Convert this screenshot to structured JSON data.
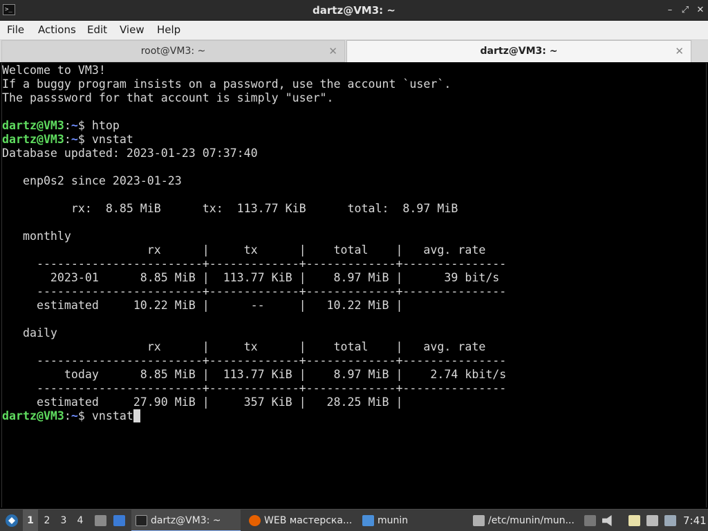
{
  "window": {
    "title": "dartz@VM3: ~",
    "app_icon_text": ">_",
    "minimize_glyph": "–",
    "maximize_glyph": "⤢",
    "close_glyph": "✕"
  },
  "menu": {
    "file": "File",
    "actions": "Actions",
    "edit": "Edit",
    "view": "View",
    "help": "Help"
  },
  "tabs": [
    {
      "label": "root@VM3: ~",
      "close": "✕",
      "active": false
    },
    {
      "label": "dartz@VM3: ~",
      "close": "✕",
      "active": true
    }
  ],
  "terminal": {
    "lines": [
      {
        "text": "Welcome to VM3!"
      },
      {
        "text": "If a buggy program insists on a password, use the account `user`."
      },
      {
        "text": "The passsword for that account is simply \"user\"."
      },
      {
        "text": ""
      },
      {
        "user": "dartz@VM3",
        "sep": ":",
        "path": "~",
        "text": "$ htop"
      },
      {
        "user": "dartz@VM3",
        "sep": ":",
        "path": "~",
        "text": "$ vnstat"
      },
      {
        "text": "Database updated: 2023-01-23 07:37:40"
      },
      {
        "text": ""
      },
      {
        "text": "   enp0s2 since 2023-01-23"
      },
      {
        "text": ""
      },
      {
        "text": "          rx:  8.85 MiB      tx:  113.77 KiB      total:  8.97 MiB"
      },
      {
        "text": ""
      },
      {
        "text": "   monthly"
      },
      {
        "text": "                     rx      |     tx      |    total    |   avg. rate"
      },
      {
        "text": "     ------------------------+-------------+-------------+---------------"
      },
      {
        "text": "       2023-01      8.85 MiB |  113.77 KiB |    8.97 MiB |      39 bit/s"
      },
      {
        "text": "     ------------------------+-------------+-------------+---------------"
      },
      {
        "text": "     estimated     10.22 MiB |      --     |   10.22 MiB |"
      },
      {
        "text": ""
      },
      {
        "text": "   daily"
      },
      {
        "text": "                     rx      |     tx      |    total    |   avg. rate"
      },
      {
        "text": "     ------------------------+-------------+-------------+---------------"
      },
      {
        "text": "         today      8.85 MiB |  113.77 KiB |    8.97 MiB |    2.74 kbit/s"
      },
      {
        "text": "     ------------------------+-------------+-------------+---------------"
      },
      {
        "text": "     estimated     27.90 MiB |     357 KiB |   28.25 MiB |"
      },
      {
        "user": "dartz@VM3",
        "sep": ":",
        "path": "~",
        "text": "$ vnstat",
        "cursor": true
      }
    ]
  },
  "taskbar": {
    "workspaces": [
      "1",
      "2",
      "3",
      "4"
    ],
    "current_workspace": "1",
    "tasks": [
      {
        "label": "dartz@VM3: ~",
        "icon": "terminal-icon",
        "active": true
      },
      {
        "label": "WEB мастерска...",
        "icon": "firefox-icon",
        "active": false
      },
      {
        "label": "munin",
        "icon": "folder-icon",
        "active": false
      },
      {
        "label": "/etc/munin/mun...",
        "icon": "text-editor-icon",
        "active": false
      }
    ],
    "clock": "7:41"
  },
  "colors": {
    "prompt_user": "#5fdc5f",
    "prompt_path": "#6f8fff",
    "terminal_bg": "#000000",
    "terminal_fg": "#d8d8d8"
  }
}
